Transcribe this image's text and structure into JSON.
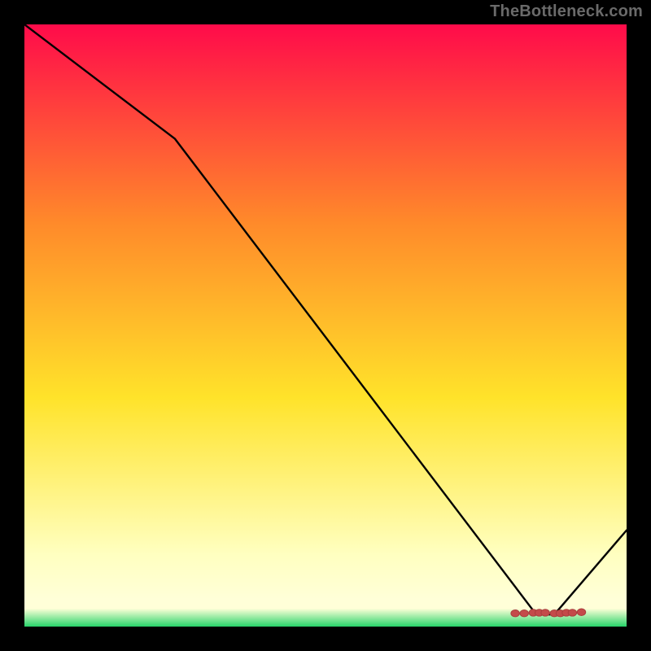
{
  "watermark": "TheBottleneck.com",
  "colors": {
    "bg": "#000000",
    "line": "#000000",
    "marker_fill": "#c44a4a",
    "marker_stroke": "#aa3d3d",
    "grad_top": "#ff0b4a",
    "grad_mid_upper": "#ff8a2a",
    "grad_mid": "#ffe32a",
    "grad_cream_top": "#ffffc0",
    "grad_cream_bot": "#ffffd8",
    "grad_green": "#27d36a"
  },
  "chart_data": {
    "type": "line",
    "title": "",
    "xlabel": "",
    "ylabel": "",
    "xlim": [
      0,
      100
    ],
    "ylim": [
      0,
      100
    ],
    "x": [
      0,
      25,
      85,
      88,
      100
    ],
    "values": [
      100,
      81,
      2,
      2,
      16
    ],
    "markers": {
      "x": [
        81.5,
        83,
        84.5,
        85.5,
        86.5,
        88,
        89,
        90,
        91,
        92.5
      ],
      "y": [
        2.2,
        2.2,
        2.3,
        2.3,
        2.3,
        2.2,
        2.2,
        2.3,
        2.3,
        2.4
      ]
    }
  }
}
